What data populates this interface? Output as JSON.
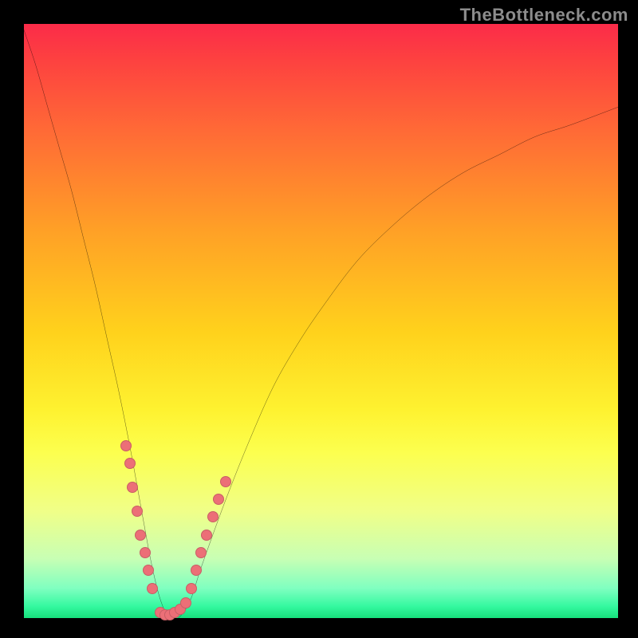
{
  "watermark": "TheBottleneck.com",
  "colors": {
    "frame": "#000000",
    "curve": "#000000",
    "dots": "#ec6f77",
    "gradient_top": "#fb2b49",
    "gradient_bottom": "#17e07c"
  },
  "chart_data": {
    "type": "line",
    "title": "",
    "xlabel": "",
    "ylabel": "",
    "xlim": [
      0,
      100
    ],
    "ylim": [
      0,
      100
    ],
    "legend": false,
    "grid": false,
    "annotations": [
      "TheBottleneck.com"
    ],
    "series": [
      {
        "name": "bottleneck-curve",
        "x": [
          0,
          2,
          4,
          6,
          8,
          10,
          12,
          14,
          16,
          18,
          20,
          21.5,
          23,
          24.5,
          26,
          28,
          30,
          34,
          38,
          42,
          46,
          50,
          56,
          62,
          68,
          74,
          80,
          86,
          92,
          100
        ],
        "y": [
          99,
          93,
          86,
          79,
          72,
          64,
          56,
          47,
          38,
          28,
          17,
          9,
          3,
          0,
          0,
          3,
          9,
          20,
          30,
          39,
          46,
          52,
          60,
          66,
          71,
          75,
          78,
          81,
          83,
          86
        ]
      }
    ],
    "scatter": [
      {
        "name": "cluster-left",
        "points": [
          [
            17.2,
            29
          ],
          [
            17.8,
            26
          ],
          [
            18.3,
            22
          ],
          [
            19.0,
            18
          ],
          [
            19.6,
            14
          ],
          [
            20.4,
            11
          ],
          [
            21.0,
            8
          ],
          [
            21.6,
            5
          ]
        ]
      },
      {
        "name": "cluster-valley",
        "points": [
          [
            23.0,
            1
          ],
          [
            23.8,
            0.5
          ],
          [
            24.6,
            0.5
          ],
          [
            25.4,
            1
          ],
          [
            26.3,
            1.5
          ],
          [
            27.2,
            2.5
          ]
        ]
      },
      {
        "name": "cluster-right",
        "points": [
          [
            28.2,
            5
          ],
          [
            29.0,
            8
          ],
          [
            29.8,
            11
          ],
          [
            30.8,
            14
          ],
          [
            31.8,
            17
          ],
          [
            32.8,
            20
          ],
          [
            34.0,
            23
          ]
        ]
      }
    ]
  }
}
